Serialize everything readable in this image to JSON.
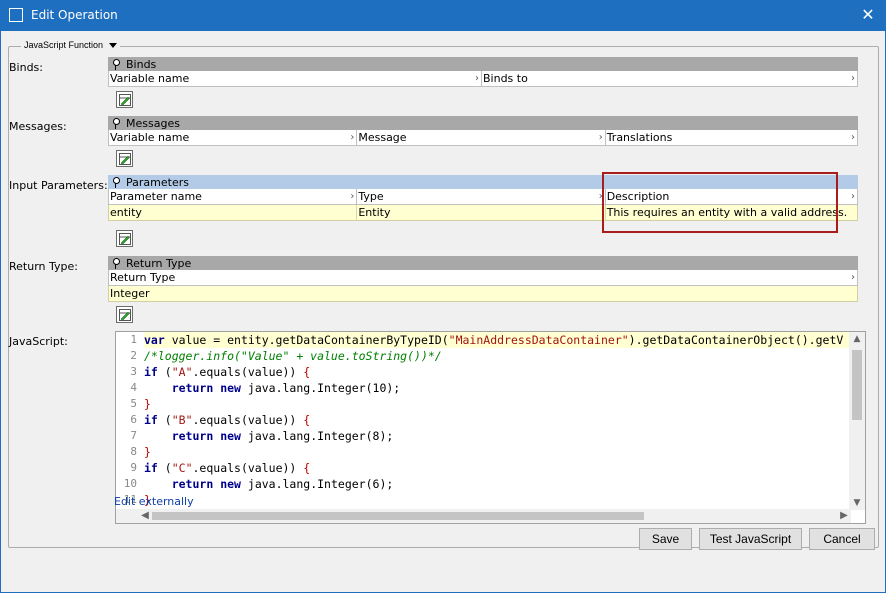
{
  "window": {
    "title": "Edit Operation"
  },
  "group": {
    "legend": "JavaScript Function"
  },
  "binds": {
    "label": "Binds:",
    "header": "Binds",
    "columns": [
      "Variable name",
      "Binds to"
    ]
  },
  "messages": {
    "label": "Messages:",
    "header": "Messages",
    "columns": [
      "Variable name",
      "Message",
      "Translations"
    ]
  },
  "input_parameters": {
    "label": "Input Parameters:",
    "header": "Parameters",
    "columns": [
      "Parameter name",
      "Type",
      "Description"
    ],
    "rows": [
      {
        "name": "entity",
        "type": "Entity",
        "description": "This requires an entity with a valid address."
      }
    ]
  },
  "return_type": {
    "label": "Return Type:",
    "header": "Return Type",
    "columns": [
      "Return Type"
    ],
    "value": "Integer"
  },
  "javascript": {
    "label": "JavaScript:",
    "line_numbers": [
      "1",
      "2",
      "3",
      "4",
      "5",
      "6",
      "7",
      "8",
      "9",
      "10",
      "11"
    ],
    "lines": [
      "var value = entity.getDataContainerByTypeID(\"MainAddressDataContainer\").getDataContainerObject().getV",
      "/*logger.info(\"Value\" + value.toString())*/",
      "if (\"A\".equals(value)) {",
      "    return new java.lang.Integer(10);",
      "}",
      "if (\"B\".equals(value)) {",
      "    return new java.lang.Integer(8);",
      "}",
      "if (\"C\".equals(value)) {",
      "    return new java.lang.Integer(6);",
      "}"
    ],
    "edit_link": "Edit externally"
  },
  "footer": {
    "save": "Save",
    "test": "Test JavaScript",
    "cancel": "Cancel"
  },
  "icons": {
    "window": "window-icon",
    "close": "close-icon",
    "pin": "pin-icon",
    "edit": "edit-table-icon"
  },
  "colors": {
    "titlebar": "#1f6fc0",
    "highlight_box": "#a81c1c",
    "selected_row": "#ffffd2",
    "active_header": "#b4cbe8"
  }
}
